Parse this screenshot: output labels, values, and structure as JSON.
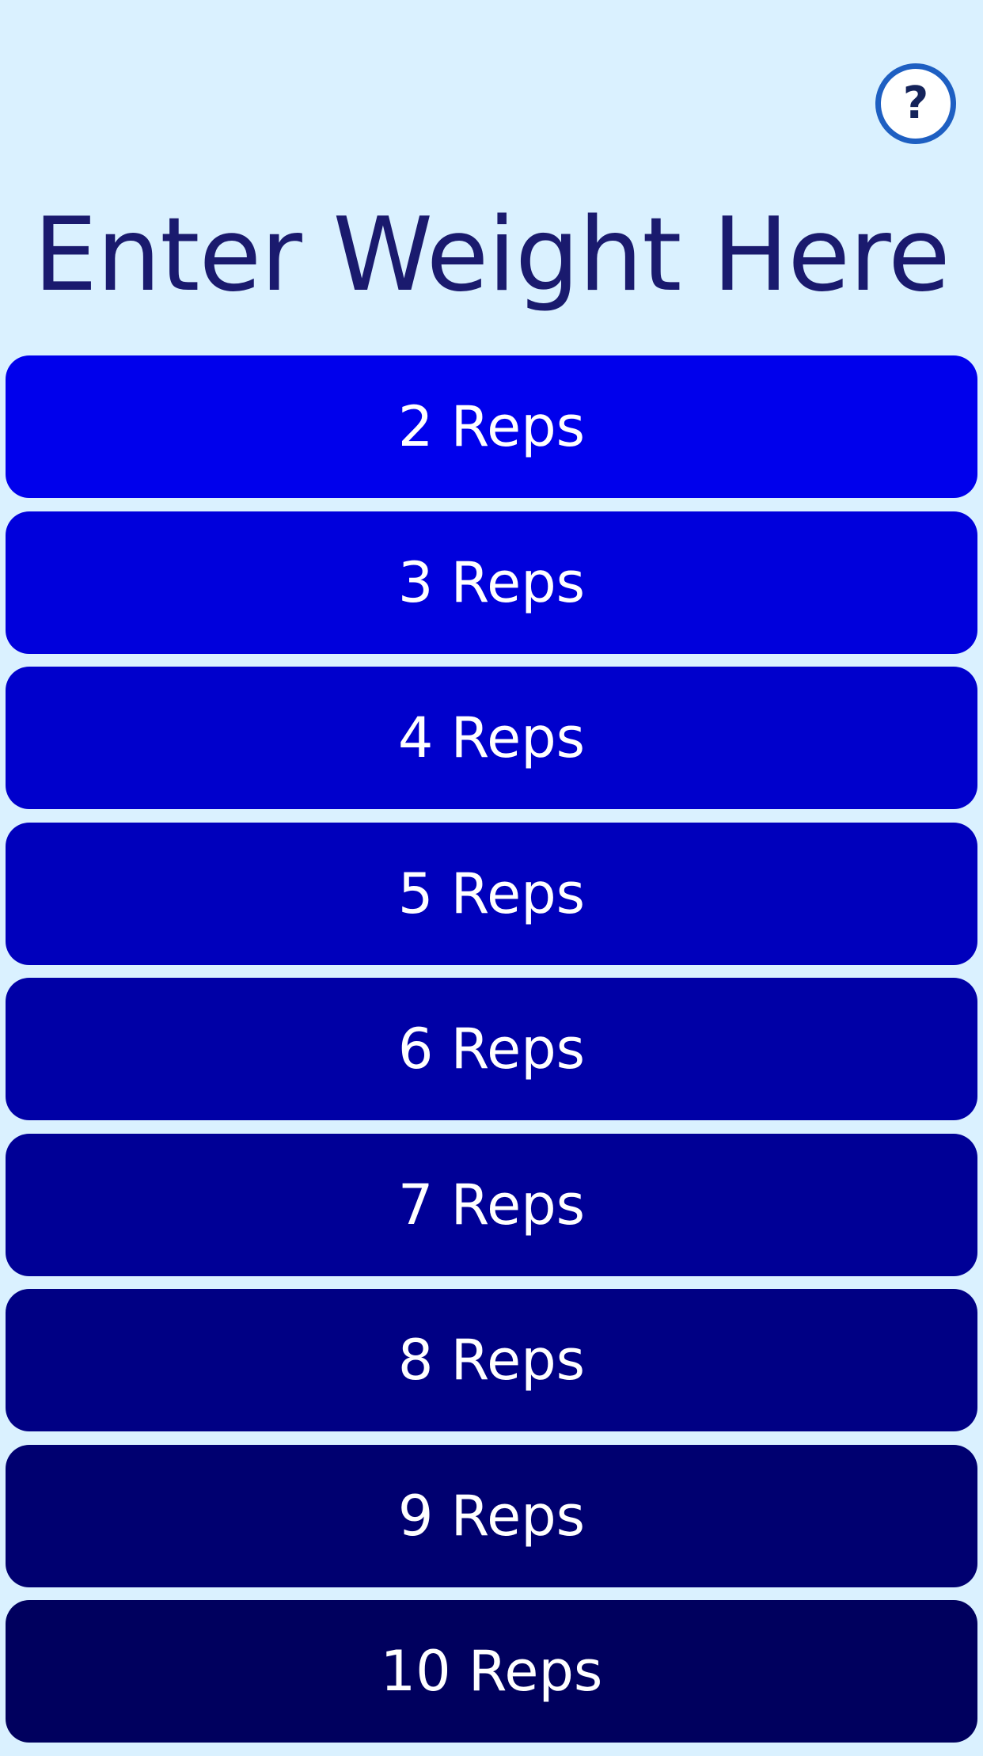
{
  "header": {
    "help_glyph": "?",
    "help_icon": "question-circle-icon",
    "title": "Enter Weight Here"
  },
  "reps": [
    {
      "label": "2 Reps",
      "color": "#0000EC"
    },
    {
      "label": "3 Reps",
      "color": "#0000DC"
    },
    {
      "label": "4 Reps",
      "color": "#0000CC"
    },
    {
      "label": "5 Reps",
      "color": "#0000BC"
    },
    {
      "label": "6 Reps",
      "color": "#0000A6"
    },
    {
      "label": "7 Reps",
      "color": "#000096"
    },
    {
      "label": "8 Reps",
      "color": "#000084"
    },
    {
      "label": "9 Reps",
      "color": "#000070"
    },
    {
      "label": "10 Reps",
      "color": "#00005E"
    }
  ],
  "colors": {
    "background": "#DAF1FF",
    "title": "#1A1A6E",
    "help_ring": "#1E5FC2"
  }
}
